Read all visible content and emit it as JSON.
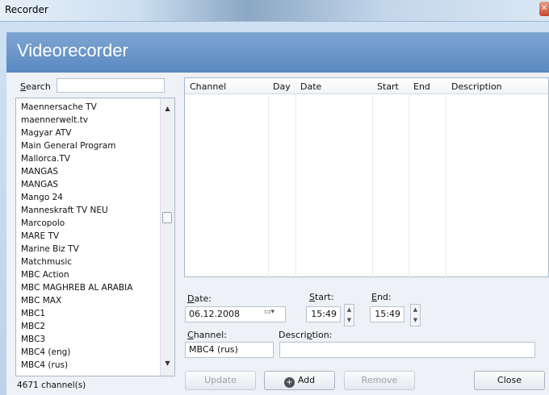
{
  "window": {
    "title": "Recorder"
  },
  "header": {
    "title": "Videorecorder"
  },
  "search": {
    "label_u": "S",
    "label_rest": "earch",
    "value": ""
  },
  "channels": {
    "items": [
      "Maennersache TV",
      "maennerwelt.tv",
      "Magyar ATV",
      "Main General Program",
      "Mallorca.TV",
      "MANGAS",
      "MANGAS",
      "Mango 24",
      "Manneskraft TV NEU",
      "Marcopolo",
      "MARE TV",
      "Marine Biz TV",
      "Matchmusic",
      "MBC Action",
      "MBC MAGHREB AL ARABIA",
      "MBC MAX",
      "MBC1",
      "MBC2",
      "MBC3",
      "MBC4 (eng)",
      "MBC4 (rus)"
    ],
    "count_text": "4671 channel(s)"
  },
  "table": {
    "columns": [
      "Channel",
      "Day",
      "Date",
      "Start",
      "End",
      "Description"
    ]
  },
  "form": {
    "date_label_u": "D",
    "date_label_rest": "ate:",
    "date_value": "06.12.2008",
    "start_label_u": "S",
    "start_label_rest": "tart:",
    "start_value": "15:49",
    "end_label_u": "E",
    "end_label_rest": "nd:",
    "end_value": "15:49",
    "channel_label_u": "C",
    "channel_label_rest": "hannel:",
    "channel_value": "MBC4 (rus)",
    "desc_label_pre": "Descri",
    "desc_label_u": "p",
    "desc_label_rest": "tion:",
    "desc_value": ""
  },
  "buttons": {
    "update": "Update",
    "add": "Add",
    "remove": "Remove",
    "close": "Close"
  },
  "icons": {
    "close": "close-icon",
    "calendar": "calendar-dropdown-icon",
    "add": "plus-circle-icon"
  }
}
